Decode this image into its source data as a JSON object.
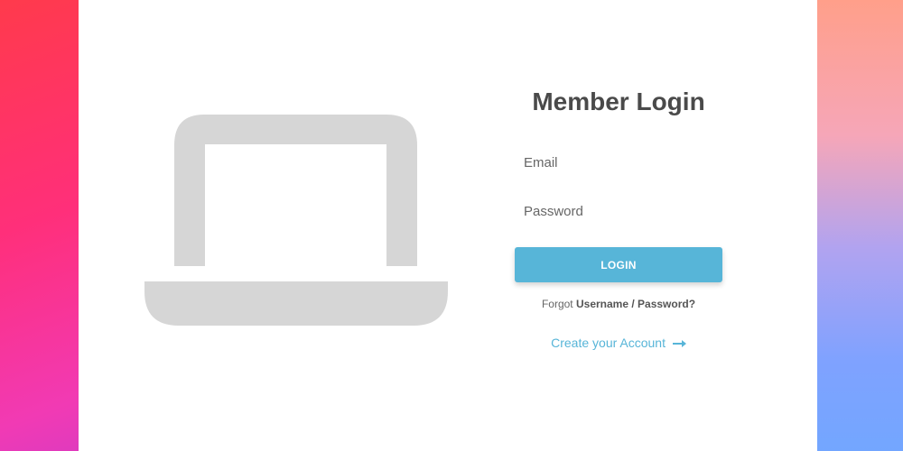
{
  "login": {
    "title": "Member Login",
    "email_placeholder": "Email",
    "password_placeholder": "Password",
    "login_label": "LOGIN",
    "forgot_prefix": "Forgot",
    "forgot_link": "Username / Password?",
    "create_account_label": "Create your Account"
  },
  "icons": {
    "illustration": "laptop-icon",
    "create_account_arrow": "arrow-right-icon"
  },
  "colors": {
    "accent": "#57b5d8",
    "illustration": "#d6d6d6",
    "title": "#4a4a4a"
  }
}
